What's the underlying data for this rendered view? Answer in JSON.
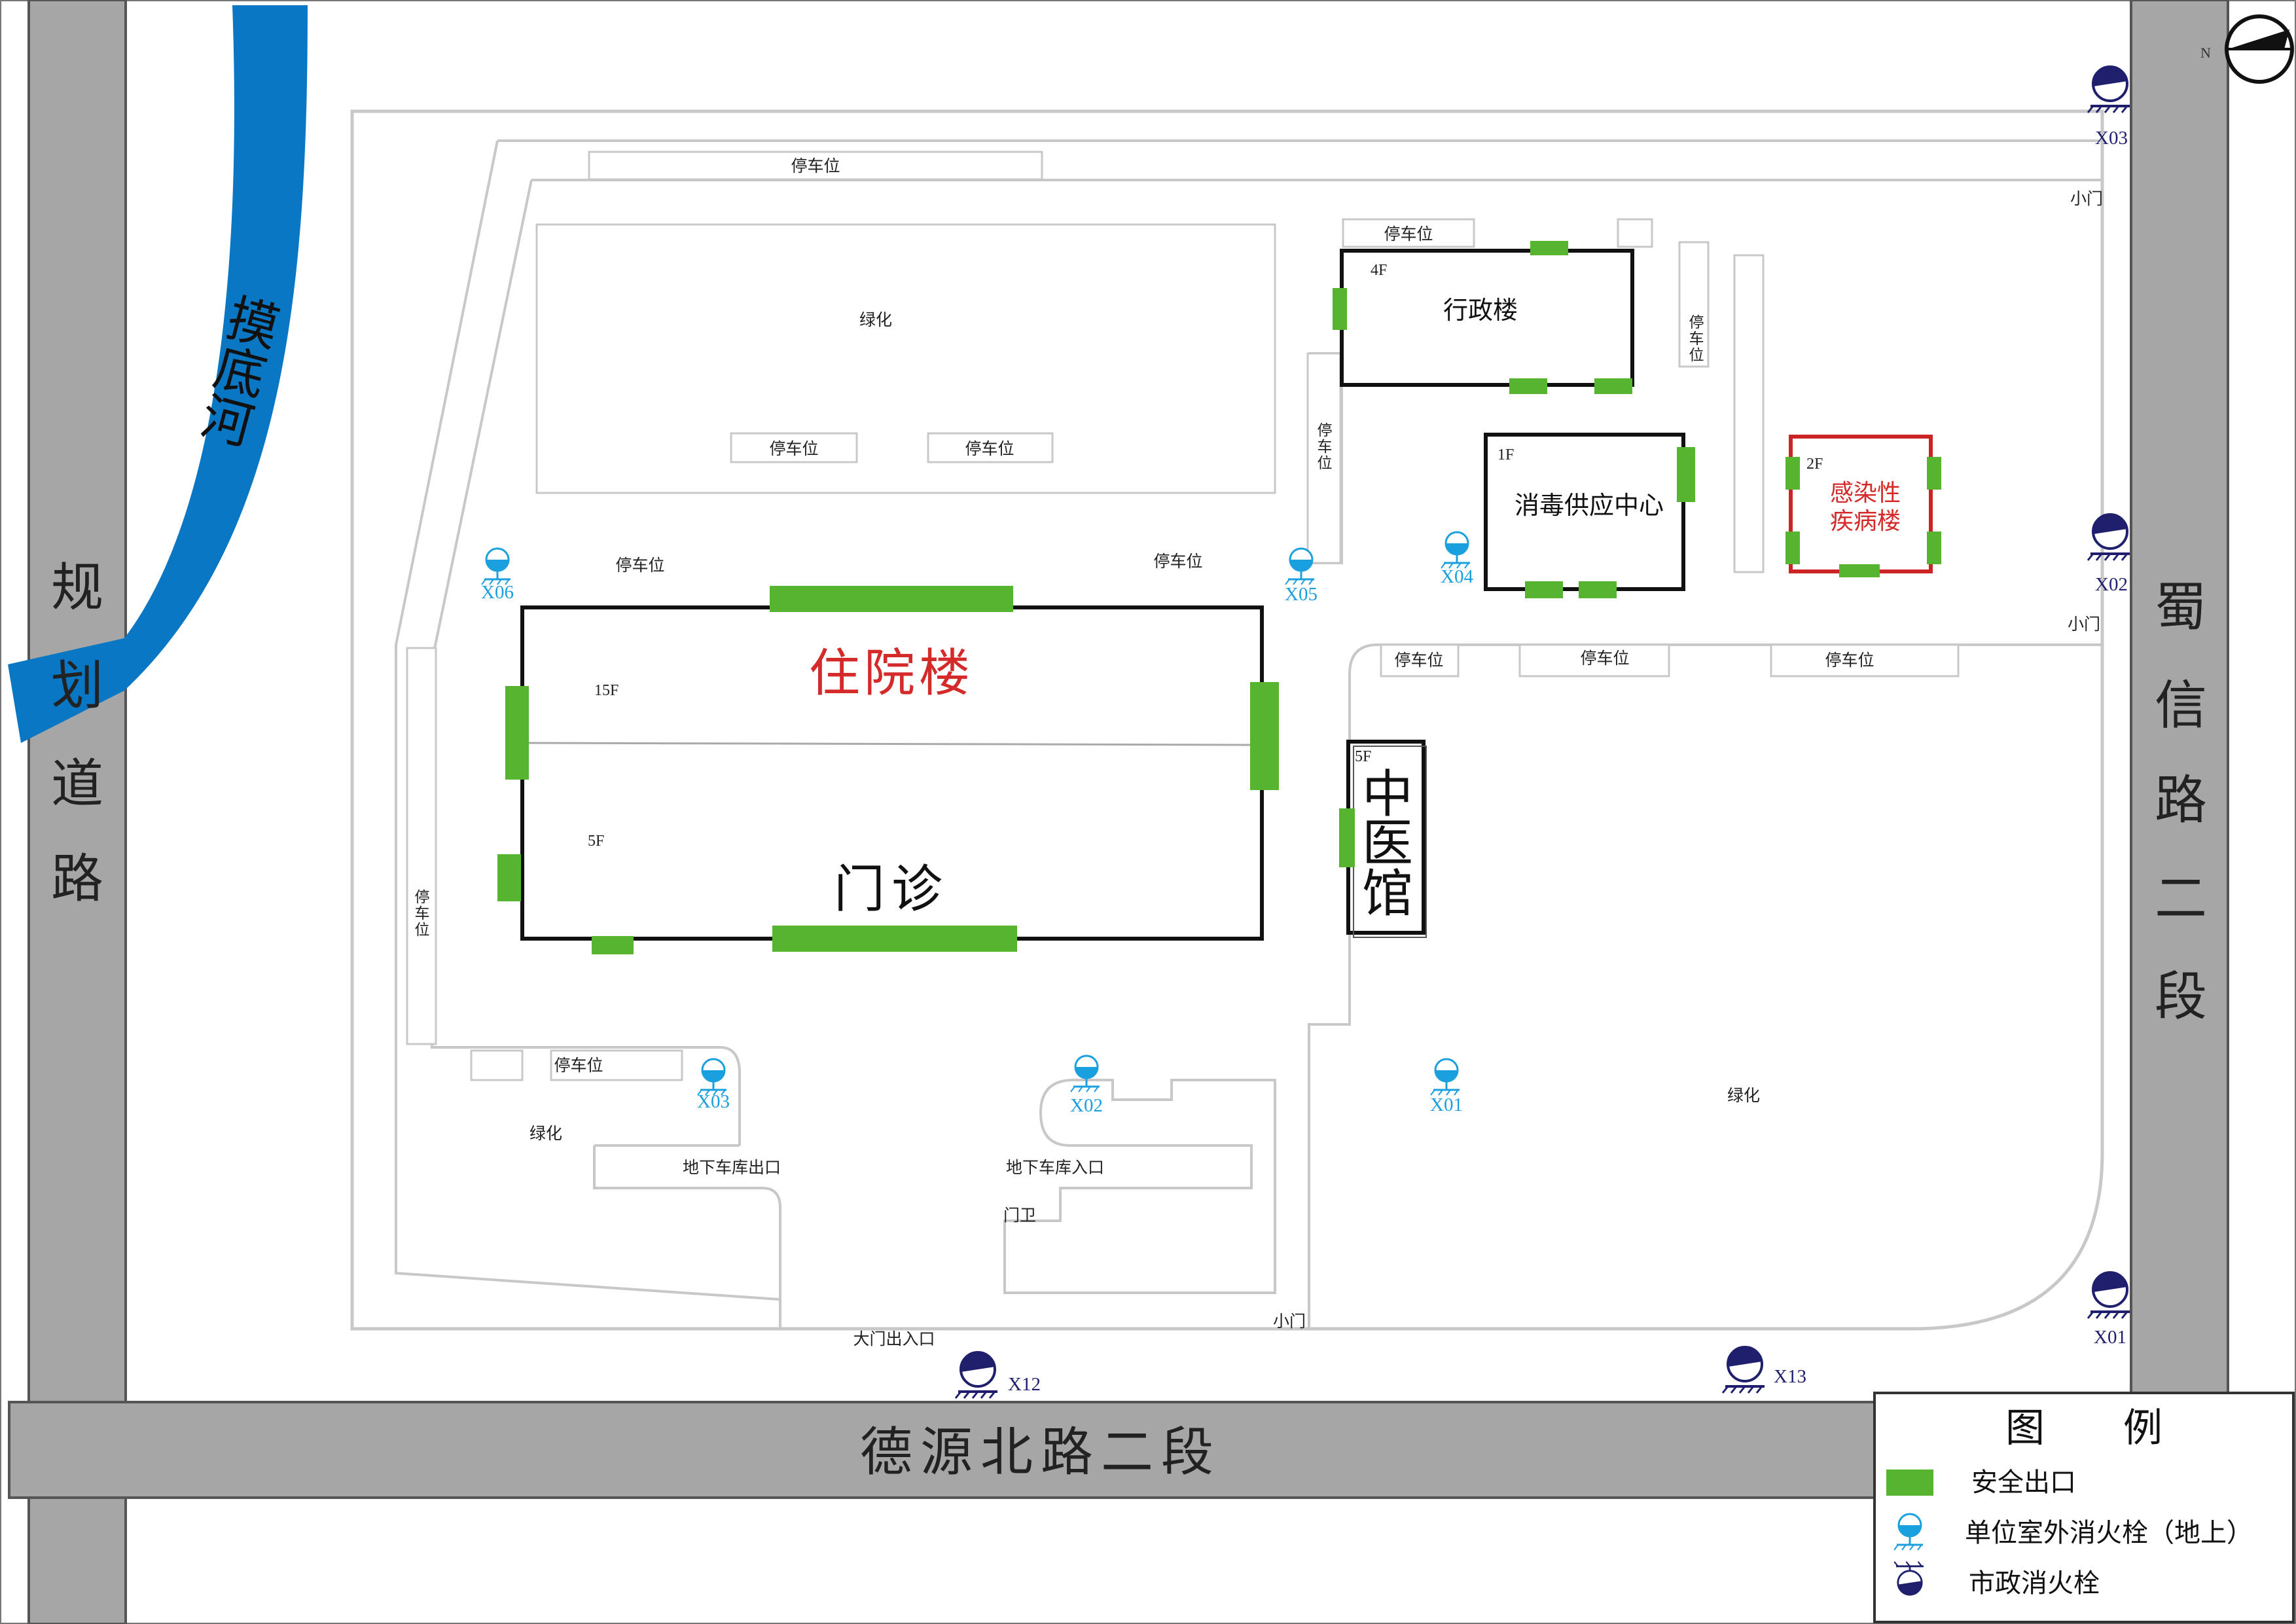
{
  "roads": {
    "west": "规划道路",
    "east": "蜀信路二段",
    "south": "德源北路二段"
  },
  "river": "摸底河",
  "buildings": {
    "inpatient": {
      "name": "住院楼",
      "floors": "15F"
    },
    "outpatient": {
      "name": "门诊",
      "floors": "5F"
    },
    "admin": {
      "name": "行政楼",
      "floors": "4F"
    },
    "disinfection": {
      "name": "消毒供应中心",
      "floors": "1F"
    },
    "infectious": {
      "name": "感染性疾病楼",
      "name_line1": "感染性",
      "name_line2": "疾病楼",
      "floors": "2F"
    },
    "tcm": {
      "name": "中医馆",
      "floors": "5F"
    }
  },
  "labels": {
    "parking": "停车位",
    "green": "绿化",
    "small_gate": "小门",
    "main_gate": "大门出入口",
    "garage_exit": "地下车库出口",
    "garage_entrance": "地下车库入口",
    "guard": "门卫",
    "north": "N"
  },
  "hydrants_unit": [
    "X01",
    "X02",
    "X03",
    "X04",
    "X05",
    "X06"
  ],
  "hydrants_municipal": [
    "X01",
    "X02",
    "X03",
    "X12",
    "X13"
  ],
  "legend": {
    "title": "图　　例",
    "exit": "安全出口",
    "unit_hydrant": "单位室外消火栓（地上）",
    "municipal_hydrant": "市政消火栓"
  },
  "colors": {
    "road": "#a6a6a6",
    "river": "#0a77c4",
    "exit": "#56b431",
    "unit_hydrant": "#1aa0df",
    "municipal_hydrant": "#1f1f6e",
    "red_text": "#d42a2a"
  }
}
